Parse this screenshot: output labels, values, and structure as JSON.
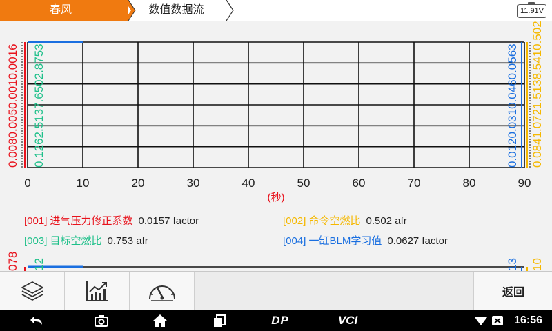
{
  "header": {
    "breadcrumb_1": "春风",
    "breadcrumb_2": "数值数据流",
    "battery_voltage": "11.91V"
  },
  "colors": {
    "accent_orange": "#f07a10",
    "series_001": "#e8121c",
    "series_002": "#f5b800",
    "series_003": "#1ec08a",
    "series_004": "#1a6fe0"
  },
  "chart_data": {
    "type": "line",
    "xlabel": "(秒)",
    "x_ticks": [
      "0",
      "10",
      "20",
      "30",
      "40",
      "50",
      "60",
      "70",
      "80",
      "90"
    ],
    "xlim": [
      0,
      90
    ],
    "grid": true,
    "left_axis_labels": {
      "series_001": "0.0080.0050.0010.0016",
      "series_003": "0.1262.5137.6502.8753"
    },
    "right_axis_labels": {
      "series_004": "0.0120.0310.0460.0563",
      "series_002": "0.0841.0721.5138.5410.502"
    },
    "series": [
      {
        "name": "[001] 进气压力修正系数",
        "value": "0.0157 factor"
      },
      {
        "name": "[002] 命令空燃比",
        "value": "0.502 afr"
      },
      {
        "name": "[003] 目标空燃比",
        "value": "0.753 afr"
      },
      {
        "name": "[004] 一缸BLM学习值",
        "value": "0.0627 factor"
      }
    ],
    "lower_chart_labels": {
      "left_red": "078",
      "left_green": "12",
      "right_blue": "13",
      "right_yellow": "10"
    }
  },
  "toolbar": {
    "layers_icon": "layers-icon",
    "chart_icon": "trend-chart-icon",
    "gauge_icon": "gauge-icon",
    "back_label": "返回"
  },
  "navbar": {
    "time": "16:56",
    "vci_label": "VCI",
    "dp_label": "DP"
  }
}
